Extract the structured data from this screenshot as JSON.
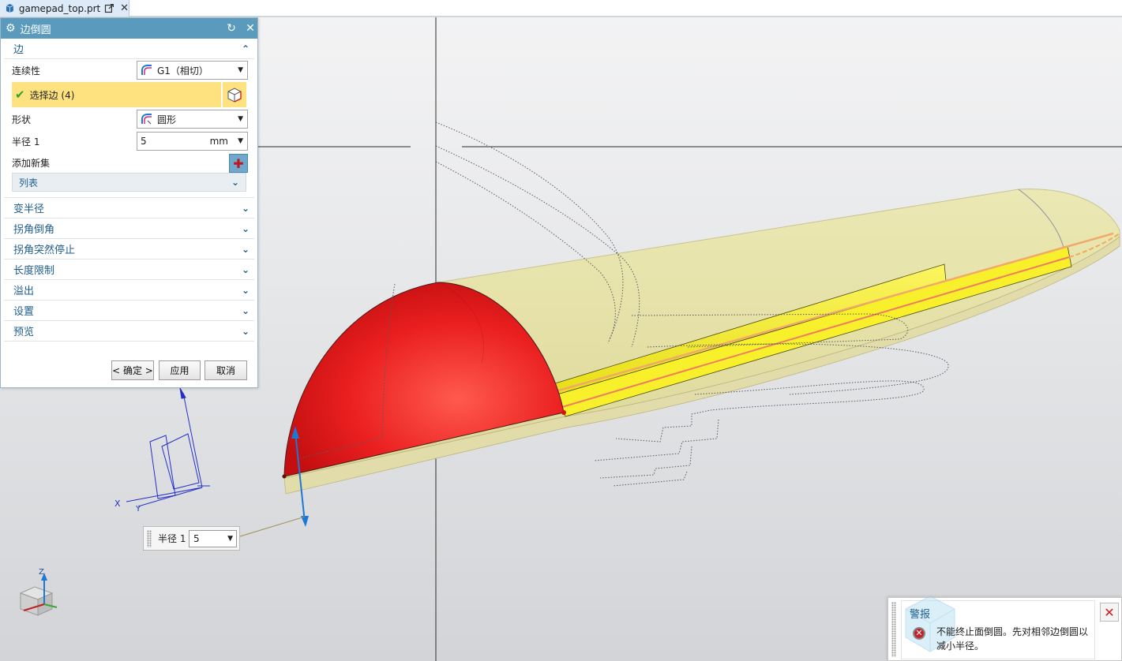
{
  "tab": {
    "filename": "gamepad_top.prt",
    "icons": [
      "part-file-icon",
      "undock-icon",
      "close-icon"
    ]
  },
  "dialog": {
    "title": "边倒圆",
    "header_icons": [
      "gear-icon",
      "reset-icon",
      "close-icon"
    ],
    "edge_section": {
      "label": "边",
      "continuity_label": "连续性",
      "continuity_value": "G1（相切）",
      "select_label": "选择边 (4)",
      "shape_label": "形状",
      "shape_value": "圆形",
      "radius_label": "半径 1",
      "radius_value": "5",
      "radius_unit": "mm",
      "add_set_label": "添加新集",
      "list_label": "列表"
    },
    "collapsed_sections": [
      "变半径",
      "拐角倒角",
      "拐角突然停止",
      "长度限制",
      "溢出",
      "设置",
      "预览"
    ],
    "buttons": {
      "ok": "< 确定 >",
      "apply": "应用",
      "cancel": "取消"
    }
  },
  "onscreen_input": {
    "label": "半径 1",
    "value": "5"
  },
  "triad": {
    "x_label": "X",
    "y_label": "Y",
    "z_label": "Z"
  },
  "alert": {
    "title": "警报",
    "message": "不能终止面倒圆。先对相邻边倒圆以减小半径。"
  },
  "colors": {
    "title_bar": "#5a9bbd",
    "selection_highlight": "#fde27f",
    "section_text": "#1f5e8c",
    "part_body": "#e8e3a2",
    "selected_face": "#ea1f1f",
    "fillet_strip": "#f7f02a"
  }
}
